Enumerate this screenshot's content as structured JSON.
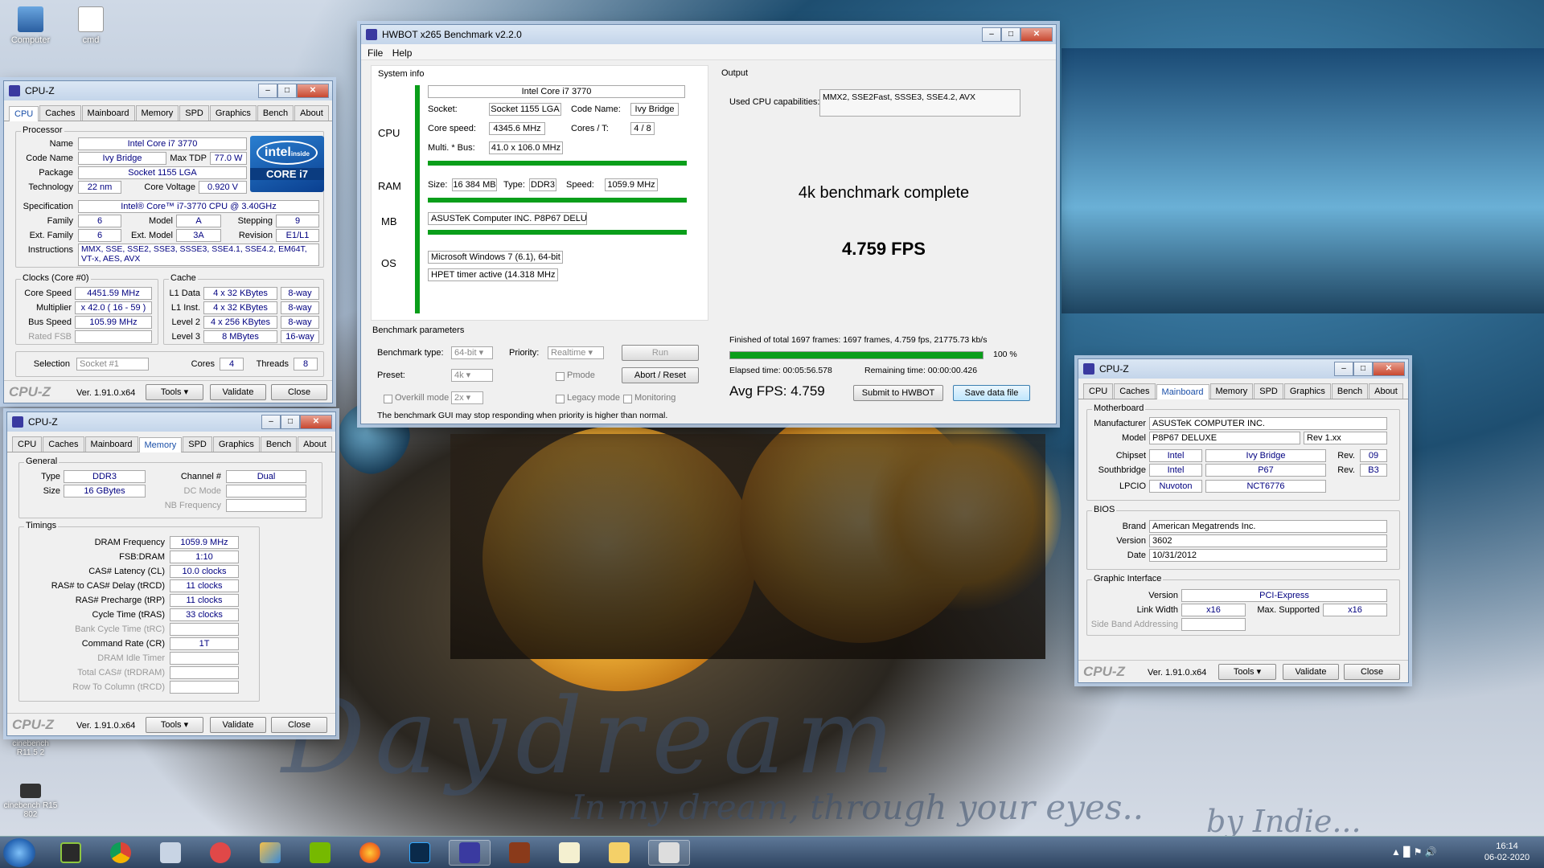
{
  "desktop": {
    "icons": [
      {
        "label": "Computer"
      },
      {
        "label": "cmd"
      },
      {
        "label": "cinebench R11.5 2"
      },
      {
        "label": "cinebench R15 802"
      }
    ],
    "wallpaper": {
      "title": "Daydream",
      "subtitle": "In my dream, through your eyes..",
      "credit": "by Indie..."
    }
  },
  "hwbot": {
    "title": "HWBOT x265 Benchmark v2.2.0",
    "menu": [
      "File",
      "Help"
    ],
    "system_info_label": "System info",
    "cpu_label": "CPU",
    "ram_label": "RAM",
    "mb_label": "MB",
    "os_label": "OS",
    "cpu_name": "Intel Core i7 3770",
    "socket_label": "Socket:",
    "socket": "Socket 1155 LGA",
    "codename_label": "Code Name:",
    "codename": "Ivy Bridge",
    "corespeed_label": "Core speed:",
    "corespeed": "4345.6 MHz",
    "cores_label": "Cores / T:",
    "cores": "4 / 8",
    "multi_label": "Multi. * Bus:",
    "multi": "41.0 x 106.0 MHz",
    "size_label": "Size:",
    "size": "16 384 MB",
    "type_label": "Type:",
    "type": "DDR3",
    "speed_label": "Speed:",
    "speed": "1059.9 MHz",
    "mb": "ASUSTeK Computer INC. P8P67 DELUXE",
    "os": "Microsoft Windows 7 (6.1), 64-bit",
    "timer": "HPET timer active (14.318 MHz )",
    "params_label": "Benchmark parameters",
    "bench_type_label": "Benchmark type:",
    "bench_type": "64-bit",
    "priority_label": "Priority:",
    "priority": "Realtime",
    "run_label": "Run",
    "preset_label": "Preset:",
    "preset": "4k",
    "pmode_label": "Pmode",
    "abort_label": "Abort / Reset",
    "overkill_label": "Overkill mode",
    "overkill": "2x",
    "legacy_label": "Legacy mode",
    "monitoring_label": "Monitoring",
    "warning": "The benchmark GUI may stop responding when priority is higher than normal.",
    "output_label": "Output",
    "capabilities_label": "Used CPU capabilities:",
    "capabilities": "MMX2, SSE2Fast, SSSE3, SSE4.2, AVX",
    "status": "4k benchmark complete",
    "fps": "4.759 FPS",
    "finished": "Finished of total 1697 frames: 1697 frames, 4.759 fps,  21775.73 kb/s",
    "progress_percent": 100,
    "progress_text": "100 %",
    "elapsed": "Elapsed time: 00:05:56.578",
    "remaining": "Remaining time: 00:00:00.426",
    "avg_fps": "Avg FPS: 4.759",
    "submit_label": "Submit to HWBOT",
    "save_label": "Save data file"
  },
  "cpuz_common": {
    "title": "CPU-Z",
    "logo": "CPU-Z",
    "version": "Ver. 1.91.0.x64",
    "tools": "Tools",
    "validate": "Validate",
    "close": "Close",
    "tabs": [
      "CPU",
      "Caches",
      "Mainboard",
      "Memory",
      "SPD",
      "Graphics",
      "Bench",
      "About"
    ]
  },
  "cpuz_cpu": {
    "processor_label": "Processor",
    "name_label": "Name",
    "name": "Intel Core i7 3770",
    "codename_label": "Code Name",
    "codename": "Ivy Bridge",
    "tdp_label": "Max TDP",
    "tdp": "77.0 W",
    "package_label": "Package",
    "package": "Socket 1155 LGA",
    "tech_label": "Technology",
    "tech": "22 nm",
    "voltage_label": "Core Voltage",
    "voltage": "0.920 V",
    "spec_label": "Specification",
    "spec": "Intel® Core™ i7-3770 CPU @ 3.40GHz",
    "family_label": "Family",
    "family": "6",
    "model_label": "Model",
    "model": "A",
    "stepping_label": "Stepping",
    "stepping": "9",
    "extfamily_label": "Ext. Family",
    "extfamily": "6",
    "extmodel_label": "Ext. Model",
    "extmodel": "3A",
    "revision_label": "Revision",
    "revision": "E1/L1",
    "instr_label": "Instructions",
    "instr": "MMX, SSE, SSE2, SSE3, SSSE3, SSE4.1, SSE4.2, EM64T, VT-x, AES, AVX",
    "clocks_label": "Clocks (Core #0)",
    "corespeed_label": "Core Speed",
    "corespeed": "4451.59 MHz",
    "mult_label": "Multiplier",
    "mult": "x 42.0 ( 16 - 59 )",
    "bus_label": "Bus Speed",
    "bus": "105.99 MHz",
    "fsb_label": "Rated FSB",
    "cache_label": "Cache",
    "l1d_label": "L1 Data",
    "l1d": "4 x 32 KBytes",
    "l1d_way": "8-way",
    "l1i_label": "L1 Inst.",
    "l1i": "4 x 32 KBytes",
    "l1i_way": "8-way",
    "l2_label": "Level 2",
    "l2": "4 x 256 KBytes",
    "l2_way": "8-way",
    "l3_label": "Level 3",
    "l3": "8 MBytes",
    "l3_way": "16-way",
    "selection_label": "Selection",
    "selection": "Socket #1",
    "cores_label": "Cores",
    "cores": "4",
    "threads_label": "Threads",
    "threads": "8",
    "intel_brand": "intel",
    "intel_inside": "inside",
    "intel_core": "CORE i7"
  },
  "cpuz_mem": {
    "general_label": "General",
    "type_label": "Type",
    "type": "DDR3",
    "size_label": "Size",
    "size": "16 GBytes",
    "channel_label": "Channel #",
    "channel": "Dual",
    "dc_label": "DC Mode",
    "nb_label": "NB Frequency",
    "timings_label": "Timings",
    "rows": [
      {
        "label": "DRAM Frequency",
        "value": "1059.9 MHz",
        "dim": false
      },
      {
        "label": "FSB:DRAM",
        "value": "1:10",
        "dim": false
      },
      {
        "label": "CAS# Latency (CL)",
        "value": "10.0 clocks",
        "dim": false
      },
      {
        "label": "RAS# to CAS# Delay (tRCD)",
        "value": "11 clocks",
        "dim": false
      },
      {
        "label": "RAS# Precharge (tRP)",
        "value": "11 clocks",
        "dim": false
      },
      {
        "label": "Cycle Time (tRAS)",
        "value": "33 clocks",
        "dim": false
      },
      {
        "label": "Bank Cycle Time (tRC)",
        "value": "",
        "dim": true
      },
      {
        "label": "Command Rate (CR)",
        "value": "1T",
        "dim": false
      },
      {
        "label": "DRAM Idle Timer",
        "value": "",
        "dim": true
      },
      {
        "label": "Total CAS# (tRDRAM)",
        "value": "",
        "dim": true
      },
      {
        "label": "Row To Column (tRCD)",
        "value": "",
        "dim": true
      }
    ]
  },
  "cpuz_mb": {
    "mb_label": "Motherboard",
    "mfr_label": "Manufacturer",
    "mfr": "ASUSTeK COMPUTER INC.",
    "model_label": "Model",
    "model": "P8P67 DELUXE",
    "model_rev": "Rev 1.xx",
    "chipset_label": "Chipset",
    "chipset_vendor": "Intel",
    "chipset": "Ivy Bridge",
    "rev_label": "Rev.",
    "chipset_rev": "09",
    "south_label": "Southbridge",
    "south_vendor": "Intel",
    "south": "P67",
    "south_rev": "B3",
    "lpcio_label": "LPCIO",
    "lpcio_vendor": "Nuvoton",
    "lpcio": "NCT6776",
    "bios_label": "BIOS",
    "brand_label": "Brand",
    "brand": "American Megatrends Inc.",
    "version_label": "Version",
    "version": "3602",
    "date_label": "Date",
    "date": "10/31/2012",
    "gi_label": "Graphic Interface",
    "giver_label": "Version",
    "giver": "PCI-Express",
    "lw_label": "Link Width",
    "lw": "x16",
    "maxs_label": "Max. Supported",
    "maxs": "x16",
    "sba_label": "Side Band Addressing"
  },
  "taskbar": {
    "time": "16:14",
    "date": "06-02-2020"
  }
}
